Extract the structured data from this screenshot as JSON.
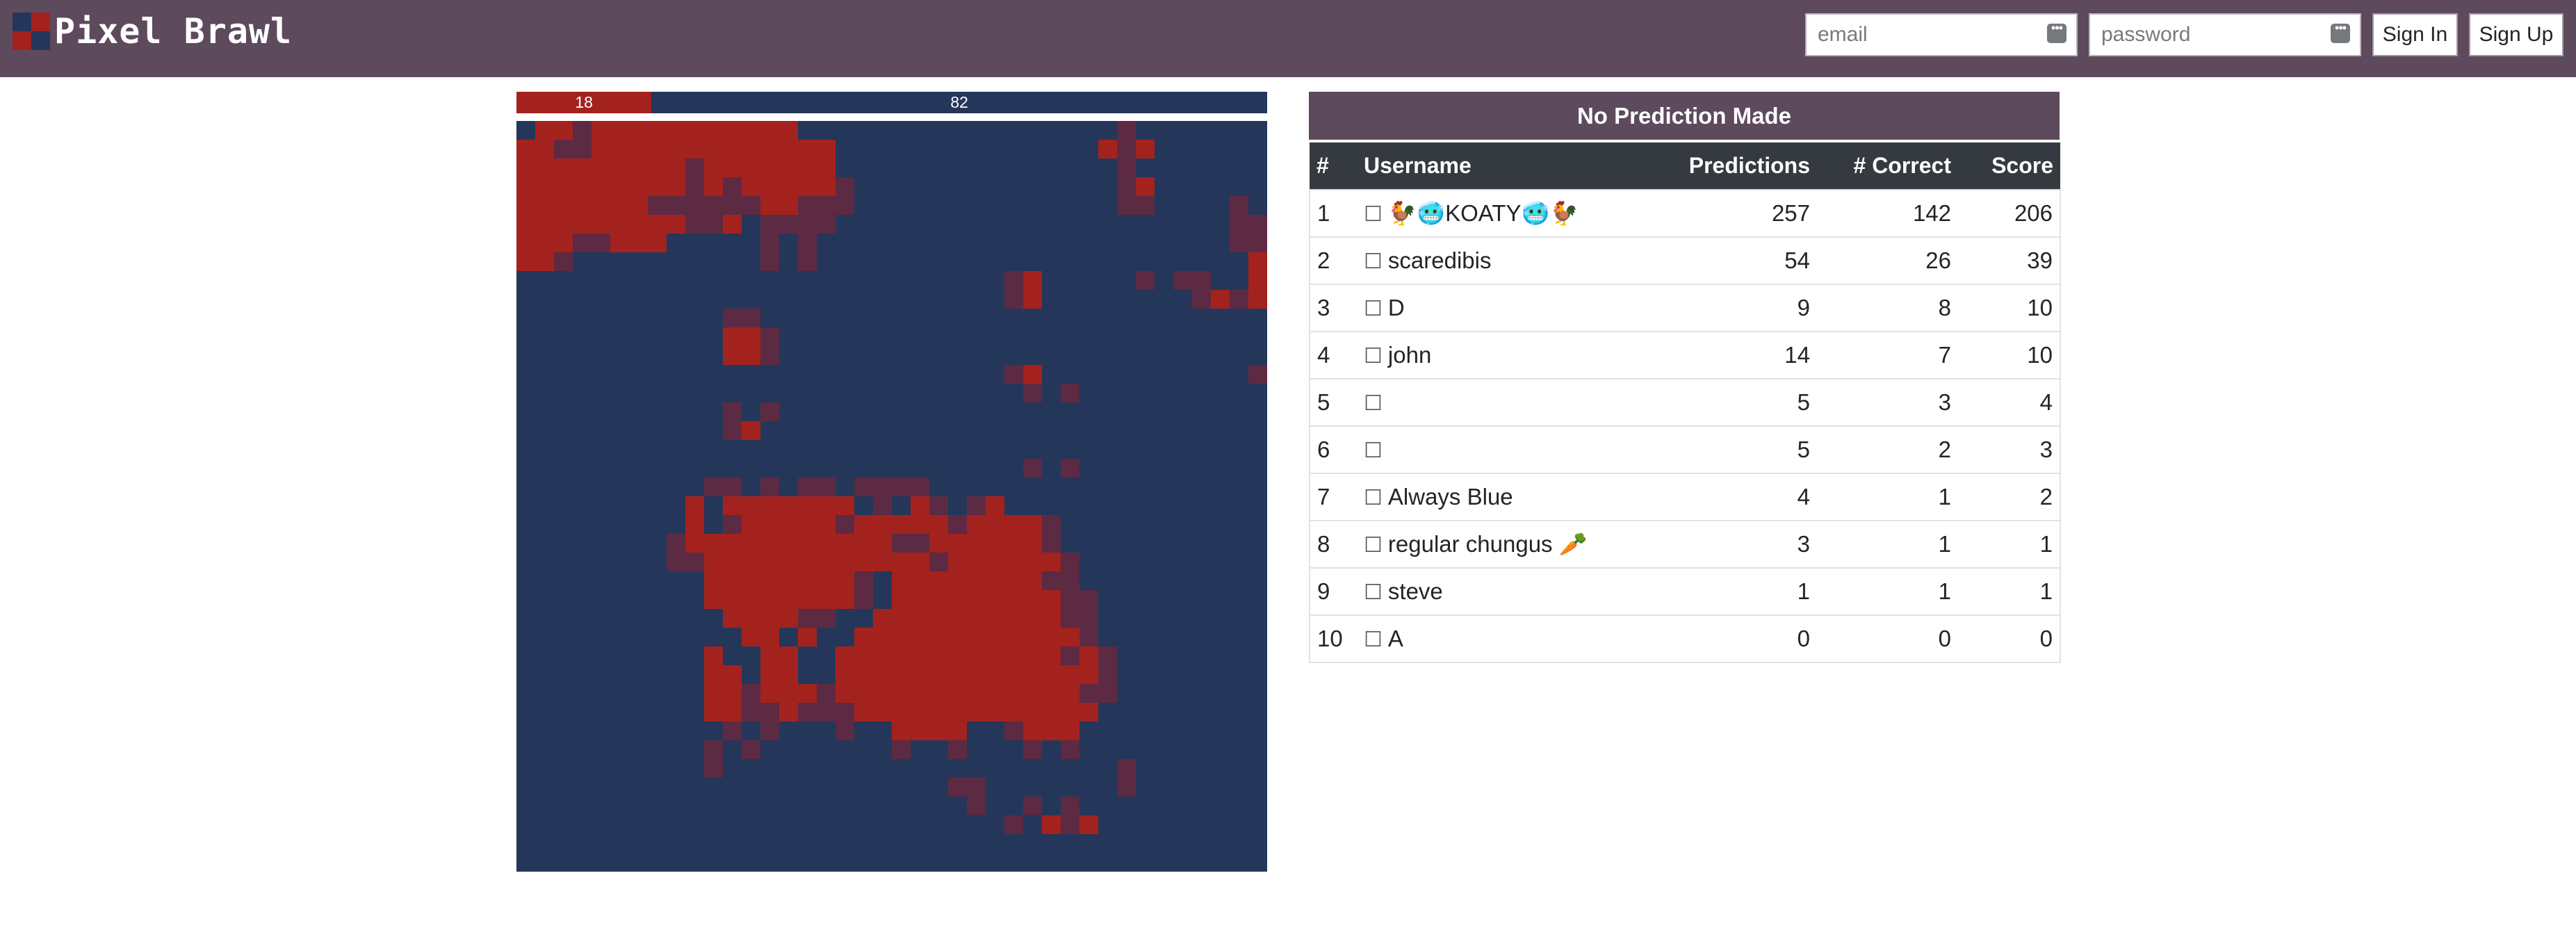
{
  "app": {
    "name": "Pixel Brawl",
    "logo_colors": [
      "#24375a",
      "#a4221e",
      "#a4221e",
      "#24375a"
    ]
  },
  "auth": {
    "email_placeholder": "email",
    "password_placeholder": "password",
    "sign_in_label": "Sign In",
    "sign_up_label": "Sign Up"
  },
  "colors": {
    "navbar": "#5d4a5c",
    "red": "#a4221e",
    "blue": "#24375a",
    "mixed": "#5c2a42",
    "table_header": "#343a40"
  },
  "score_bar": {
    "red_value": "18",
    "blue_value": "82"
  },
  "board": {
    "grid_size": 40,
    "legend": {
      ".": "blue",
      "r": "red",
      "m": "mixed"
    },
    "rows": [
      ".rrmrrrrrrrrrrr.................m.......",
      "rrmmrrrrrrrrrrrrr..............rmr......",
      "rrrrrrrrrmrrrrrrr...............m.......",
      "rrrrrrrrrmrmrrrrrm..............mr......",
      "rrrrrrrmmmmmmrrmmm..............mm....m.",
      "rrrrrrrrrmmr.mmmm.....................mm",
      "rrrmmrrr.....m.m......................mm",
      "rrm..........m.m.......................r",
      "..........................mr.....m.mm..r",
      "..........................mr........mrmr",
      "...........mm...........................",
      "...........rrm..........................",
      "...........rrm..........................",
      "..........................mr...........m",
      "...........................m.m..........",
      "...........m.m..........................",
      "...........mr...........................",
      "........................................",
      "...........................m.m..........",
      "..........mm.m.mm.mmmm..................",
      ".........r.rrrrrrr.m.rm.mr..............",
      ".........r.mrrrrrmrrrrrmrrrrm...........",
      "........mrrrrrrrrrrrmmrrrrrrm...........",
      "........mmrrrrrrrrrrrrmrrrrrrm..........",
      "..........rrrrrrrrm.rrrrrrrrmm..........",
      "..........rrrrrrrrm.rrrrrrrrrmm.........",
      "...........rrrrmm..rrrrrrrrrrmm.........",
      "............rr.r..rrrrrrrrrrrrm.........",
      "..........r..rr..rrrrrrrrrrrrmrm........",
      "..........rr.rr..rrrrrrrrrrrrrrm........",
      "..........rrmrrrmrrrrrrrrrrrrrmm........",
      "..........rrmmrmmmrrrrrrrrrrrrr.........",
      "...........m.m...m..rrrr..mrrr..........",
      "..........m.m.......m..m...m.m..........",
      "..........m.....................m.......",
      ".......................mm.......m.......",
      "........................m..m.m..........",
      "..........................m.rmr.........",
      "........................................",
      "........................................"
    ]
  },
  "predictions": {
    "status": "No Prediction Made",
    "columns": [
      "#",
      "Username",
      "Predictions",
      "# Correct",
      "Score"
    ],
    "rows": [
      {
        "rank": "1",
        "username": "🐓🥶KOATY🥶🐓",
        "predictions": "257",
        "correct": "142",
        "score": "206"
      },
      {
        "rank": "2",
        "username": "scaredibis",
        "predictions": "54",
        "correct": "26",
        "score": "39"
      },
      {
        "rank": "3",
        "username": "D",
        "predictions": "9",
        "correct": "8",
        "score": "10"
      },
      {
        "rank": "4",
        "username": "john",
        "predictions": "14",
        "correct": "7",
        "score": "10"
      },
      {
        "rank": "5",
        "username": "",
        "predictions": "5",
        "correct": "3",
        "score": "4"
      },
      {
        "rank": "6",
        "username": "",
        "predictions": "5",
        "correct": "2",
        "score": "3"
      },
      {
        "rank": "7",
        "username": "Always Blue",
        "predictions": "4",
        "correct": "1",
        "score": "2"
      },
      {
        "rank": "8",
        "username": "regular chungus 🥕",
        "predictions": "3",
        "correct": "1",
        "score": "1"
      },
      {
        "rank": "9",
        "username": "steve",
        "predictions": "1",
        "correct": "1",
        "score": "1"
      },
      {
        "rank": "10",
        "username": "A",
        "predictions": "0",
        "correct": "0",
        "score": "0"
      }
    ]
  }
}
